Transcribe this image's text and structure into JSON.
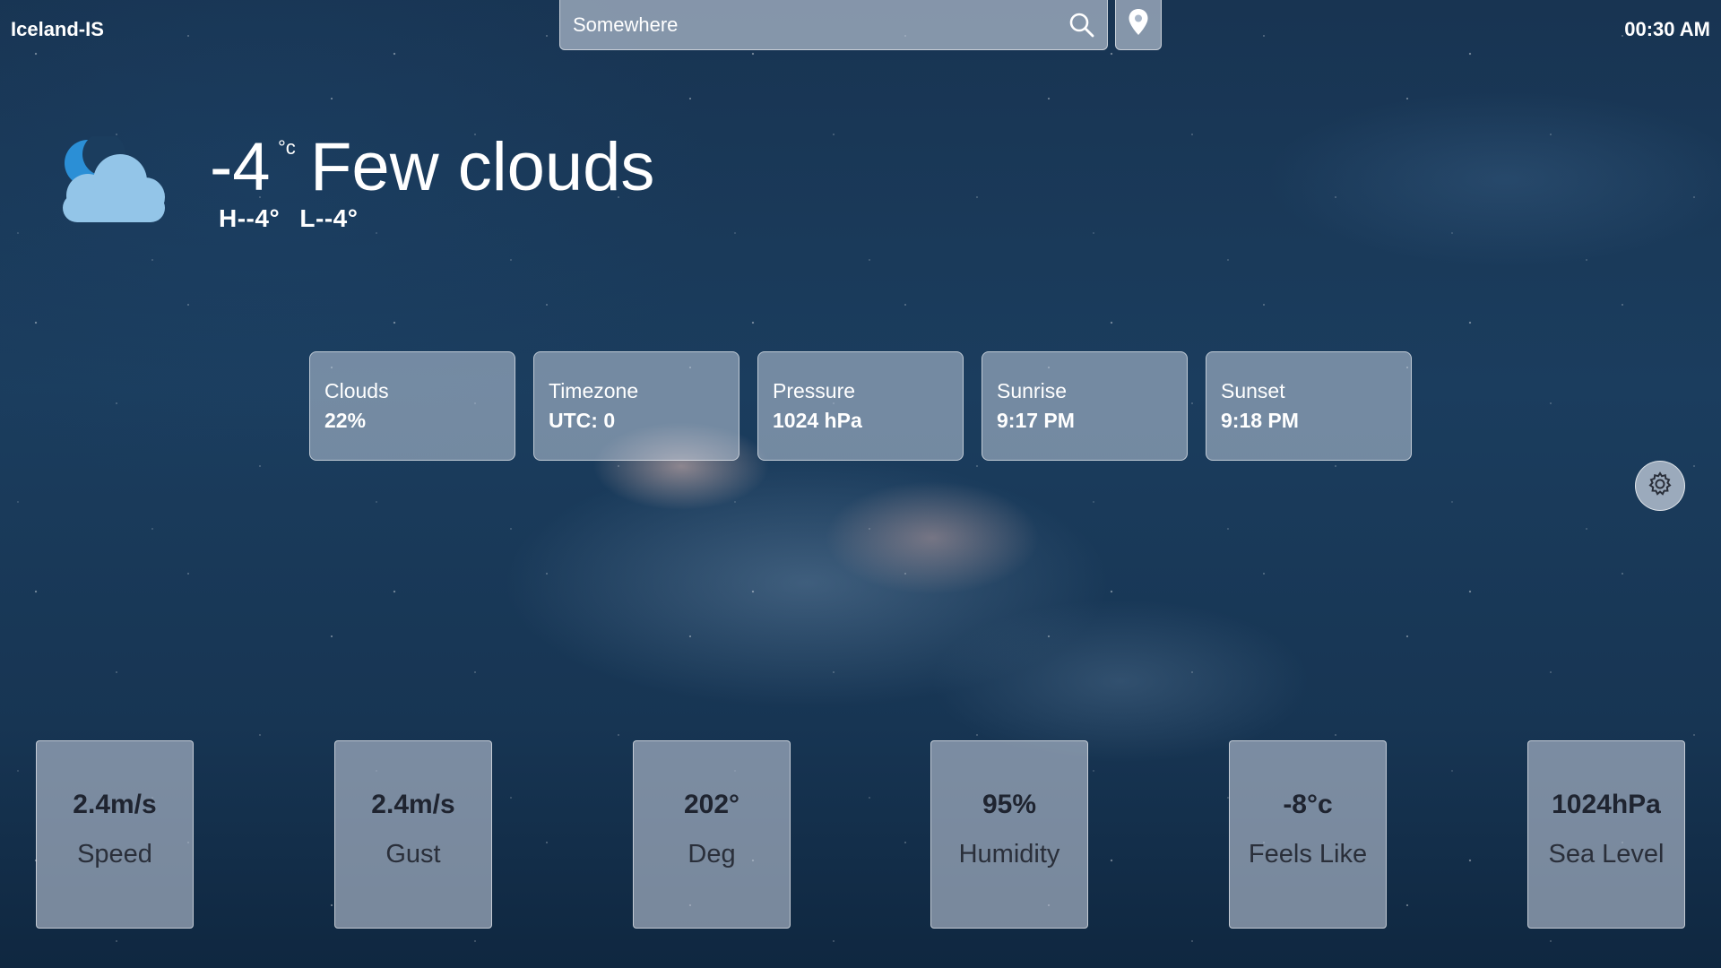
{
  "header": {
    "location": "Iceland-IS",
    "time": "00:30 AM"
  },
  "search": {
    "placeholder": "Somewhere",
    "value": "",
    "search_icon": "search-icon",
    "location_icon": "map-pin-icon"
  },
  "current": {
    "icon": "moon-cloud-icon",
    "temperature": "-4",
    "unit": "°c",
    "condition": "Few clouds",
    "high": "H--4°",
    "low": "L--4°"
  },
  "info_cards": [
    {
      "label": "Clouds",
      "value": "22%"
    },
    {
      "label": "Timezone",
      "value": "UTC: 0"
    },
    {
      "label": "Pressure",
      "value": "1024 hPa"
    },
    {
      "label": "Sunrise",
      "value": "9:17 PM"
    },
    {
      "label": "Sunset",
      "value": "9:18 PM"
    }
  ],
  "settings": {
    "icon": "gear-icon"
  },
  "stat_cards": [
    {
      "value": "2.4m/s",
      "label": "Speed"
    },
    {
      "value": "2.4m/s",
      "label": "Gust"
    },
    {
      "value": "202°",
      "label": "Deg"
    },
    {
      "value": "95%",
      "label": "Humidity"
    },
    {
      "value": "-8°c",
      "label": "Feels Like"
    },
    {
      "value": "1024hPa",
      "label": "Sea Level"
    }
  ],
  "colors": {
    "background": "#1b3d5e",
    "card": "#bccada",
    "cloud_icon": "#93c5e8",
    "moon_icon": "#2b8fd6",
    "stat_text": "#1f2430"
  }
}
